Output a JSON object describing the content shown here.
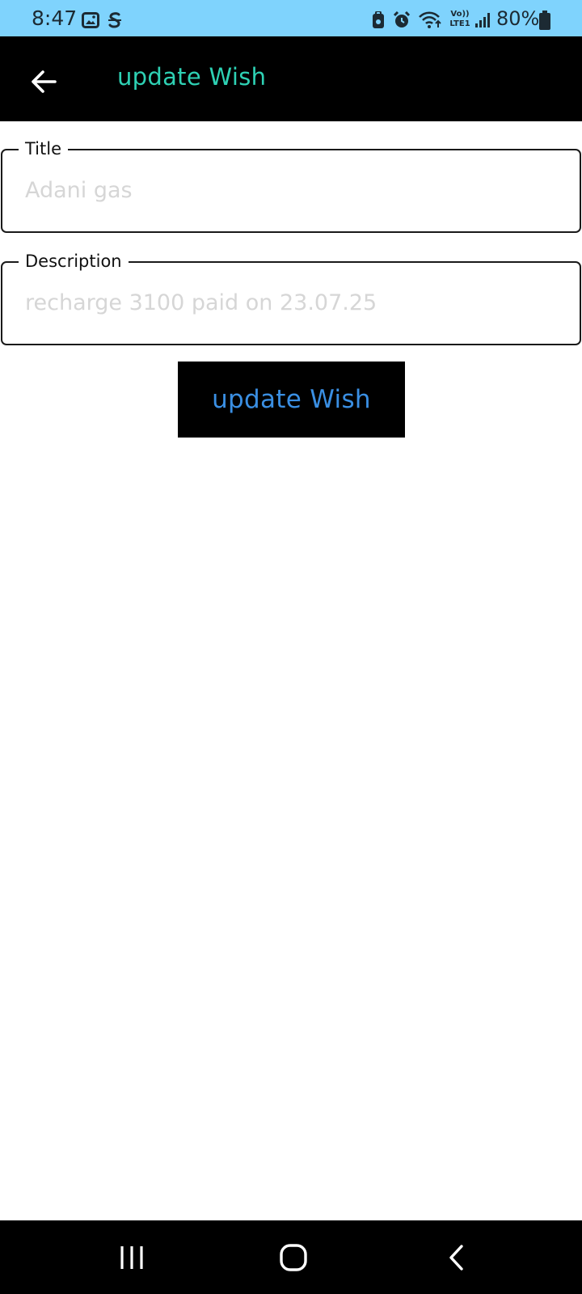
{
  "status_bar": {
    "time": "8:47",
    "battery_percent": "80%",
    "background_color": "#7fd3fd",
    "left_icons": [
      "image-icon",
      "sync-s-icon"
    ],
    "right_icons": [
      "lock-phone-icon",
      "alarm-icon",
      "wifi-icon",
      "volte-icon",
      "signal-icon",
      "battery-icon"
    ],
    "volte_text": "Vo))",
    "lte_text": "LTE1"
  },
  "app_bar": {
    "title": "update Wish",
    "back_icon": "arrow-left-icon",
    "background_color": "#000000",
    "title_color": "#2ed1b4"
  },
  "form": {
    "title_field": {
      "label": "Title",
      "value": "Adani gas"
    },
    "description_field": {
      "label": "Description",
      "value": "recharge 3100 paid on 23.07.25"
    },
    "submit_button": {
      "label": "update Wish",
      "text_color": "#3a8fe3"
    }
  },
  "nav_bar": {
    "buttons": [
      "recent-apps-icon",
      "home-icon",
      "back-icon"
    ]
  }
}
